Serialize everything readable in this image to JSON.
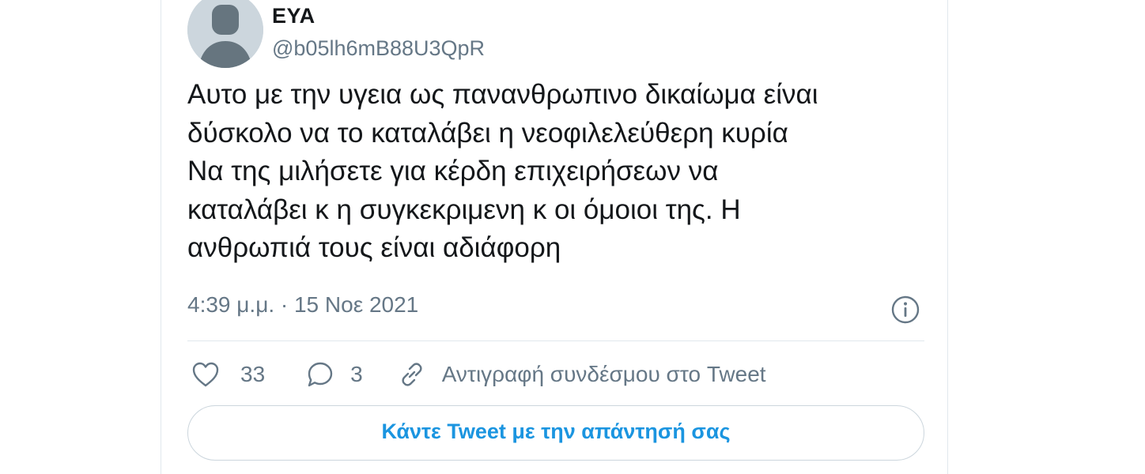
{
  "author": {
    "display_name": "ΕΥΑ",
    "handle": "@b05lh6mB88U3QpR",
    "avatar_icon": "default-avatar-icon"
  },
  "tweet": {
    "text": "Αυτο με την υγεια ως πανανθρωπινο δικαίωμα είναι\nδύσκολο να το καταλάβει η νεοφιλελεύθερη κυρία\nΝα της μιλήσετε για κέρδη επιχειρήσεων να\nκαταλάβει κ η συγκεκριμενη κ οι όμοιοι της. Η\nανθρωπιά τους είναι αδιάφορη",
    "timestamp": "4:39 μ.μ. · 15 Νοε 2021"
  },
  "actions": {
    "like_count": "33",
    "reply_count": "3",
    "copy_link_label": "Αντιγραφή συνδέσμου στο Tweet",
    "icons": [
      "heart-icon",
      "comment-icon",
      "link-icon",
      "info-icon"
    ]
  },
  "reply_button": {
    "label": "Κάντε Tweet με την απάντησή σας"
  },
  "colors": {
    "secondary_text": "#657786",
    "accent": "#1b95e0",
    "border": "#e1e8ed"
  }
}
